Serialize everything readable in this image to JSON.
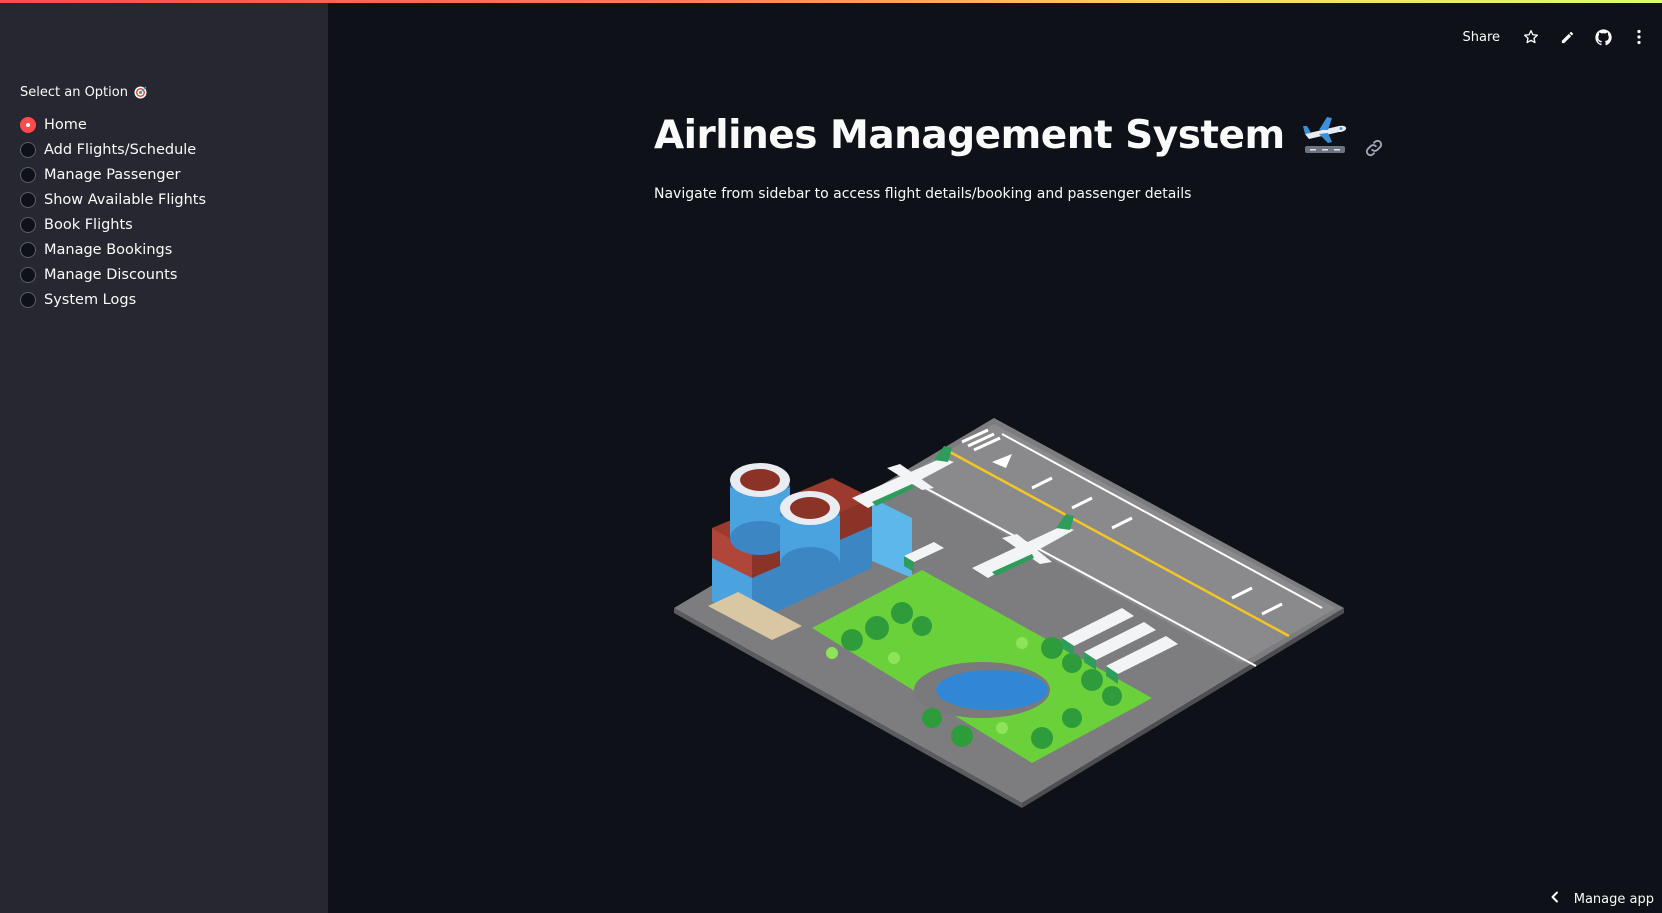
{
  "sidebar": {
    "radio_label": "Select an Option",
    "label_icon": "target-icon",
    "options": [
      {
        "label": "Home",
        "checked": true
      },
      {
        "label": "Add Flights/Schedule",
        "checked": false
      },
      {
        "label": "Manage Passenger",
        "checked": false
      },
      {
        "label": "Show Available Flights",
        "checked": false
      },
      {
        "label": "Book Flights",
        "checked": false
      },
      {
        "label": "Manage Bookings",
        "checked": false
      },
      {
        "label": "Manage Discounts",
        "checked": false
      },
      {
        "label": "System Logs",
        "checked": false
      }
    ]
  },
  "toolbar": {
    "share_label": "Share",
    "icons": [
      "star-icon",
      "pencil-icon",
      "github-icon",
      "more-vertical-icon"
    ]
  },
  "main": {
    "title": "Airlines Management System",
    "title_emoji": "airplane-departure-icon",
    "subtitle": "Navigate from sidebar to access flight details/booking and passenger details",
    "hero_image": "isometric-airport-illustration"
  },
  "footer": {
    "manage_app_label": "Manage app"
  },
  "colors": {
    "accent": "#ff4b4b",
    "sidebar_bg": "#262730",
    "main_bg": "#0e1117",
    "text": "#fafafa"
  }
}
